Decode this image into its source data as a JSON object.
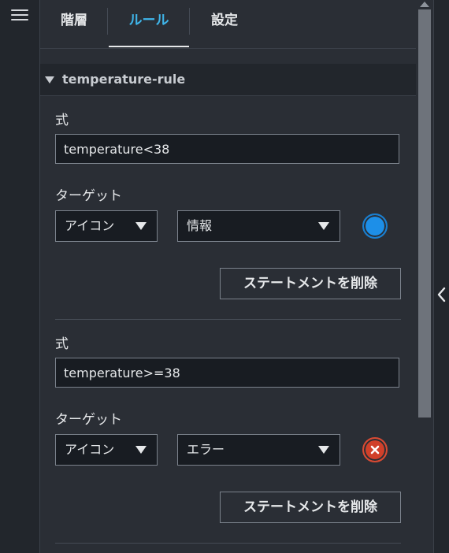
{
  "tabs": [
    {
      "label": "階層",
      "active": false
    },
    {
      "label": "ルール",
      "active": true
    },
    {
      "label": "設定",
      "active": false
    }
  ],
  "rule": {
    "name": "temperature-rule",
    "statements": [
      {
        "expression_label": "式",
        "expression": "temperature<38",
        "target_label": "ターゲット",
        "target_type": "アイコン",
        "target_value": "情報",
        "icon": "info-icon",
        "icon_color": "#1d8fe8",
        "delete_label": "ステートメントを削除"
      },
      {
        "expression_label": "式",
        "expression": "temperature>=38",
        "target_label": "ターゲット",
        "target_type": "アイコン",
        "target_value": "エラー",
        "icon": "error-icon",
        "icon_color": "#d0402a",
        "delete_label": "ステートメントを削除"
      }
    ]
  },
  "colors": {
    "accent": "#3fb4e8",
    "background": "#2a2e35",
    "input_background": "#181c22"
  }
}
